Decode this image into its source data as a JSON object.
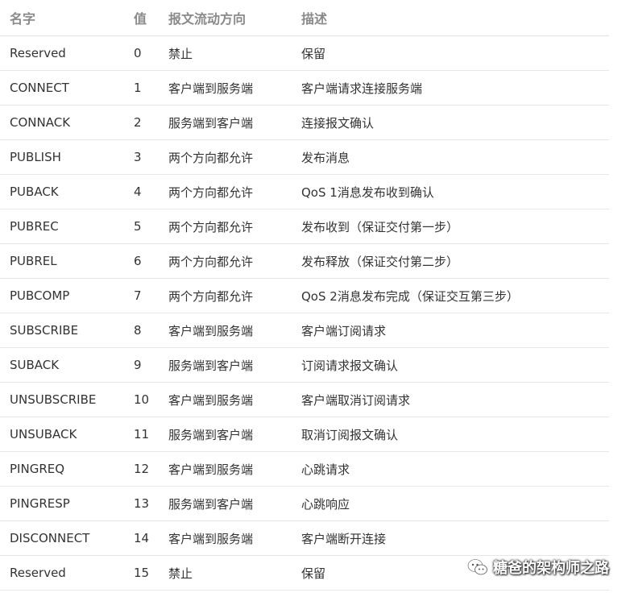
{
  "table": {
    "headers": [
      "名字",
      "值",
      "报文流动方向",
      "描述"
    ],
    "rows": [
      [
        "Reserved",
        "0",
        "禁止",
        "保留"
      ],
      [
        "CONNECT",
        "1",
        "客户端到服务端",
        "客户端请求连接服务端"
      ],
      [
        "CONNACK",
        "2",
        "服务端到客户端",
        "连接报文确认"
      ],
      [
        "PUBLISH",
        "3",
        "两个方向都允许",
        "发布消息"
      ],
      [
        "PUBACK",
        "4",
        "两个方向都允许",
        "QoS 1消息发布收到确认"
      ],
      [
        "PUBREC",
        "5",
        "两个方向都允许",
        "发布收到（保证交付第一步）"
      ],
      [
        "PUBREL",
        "6",
        "两个方向都允许",
        "发布释放（保证交付第二步）"
      ],
      [
        "PUBCOMP",
        "7",
        "两个方向都允许",
        "QoS 2消息发布完成（保证交互第三步）"
      ],
      [
        "SUBSCRIBE",
        "8",
        "客户端到服务端",
        "客户端订阅请求"
      ],
      [
        "SUBACK",
        "9",
        "服务端到客户端",
        "订阅请求报文确认"
      ],
      [
        "UNSUBSCRIBE",
        "10",
        "客户端到服务端",
        "客户端取消订阅请求"
      ],
      [
        "UNSUBACK",
        "11",
        "服务端到客户端",
        "取消订阅报文确认"
      ],
      [
        "PINGREQ",
        "12",
        "客户端到服务端",
        "心跳请求"
      ],
      [
        "PINGRESP",
        "13",
        "服务端到客户端",
        "心跳响应"
      ],
      [
        "DISCONNECT",
        "14",
        "客户端到服务端",
        "客户端断开连接"
      ],
      [
        "Reserved",
        "15",
        "禁止",
        "保留"
      ]
    ]
  },
  "watermark": {
    "text": "糖爸的架构师之路",
    "icon": "wechat-icon"
  },
  "colors": {
    "header_text": "#8a8a8a",
    "body_text": "#333333",
    "divider": "#e7e7e7"
  }
}
